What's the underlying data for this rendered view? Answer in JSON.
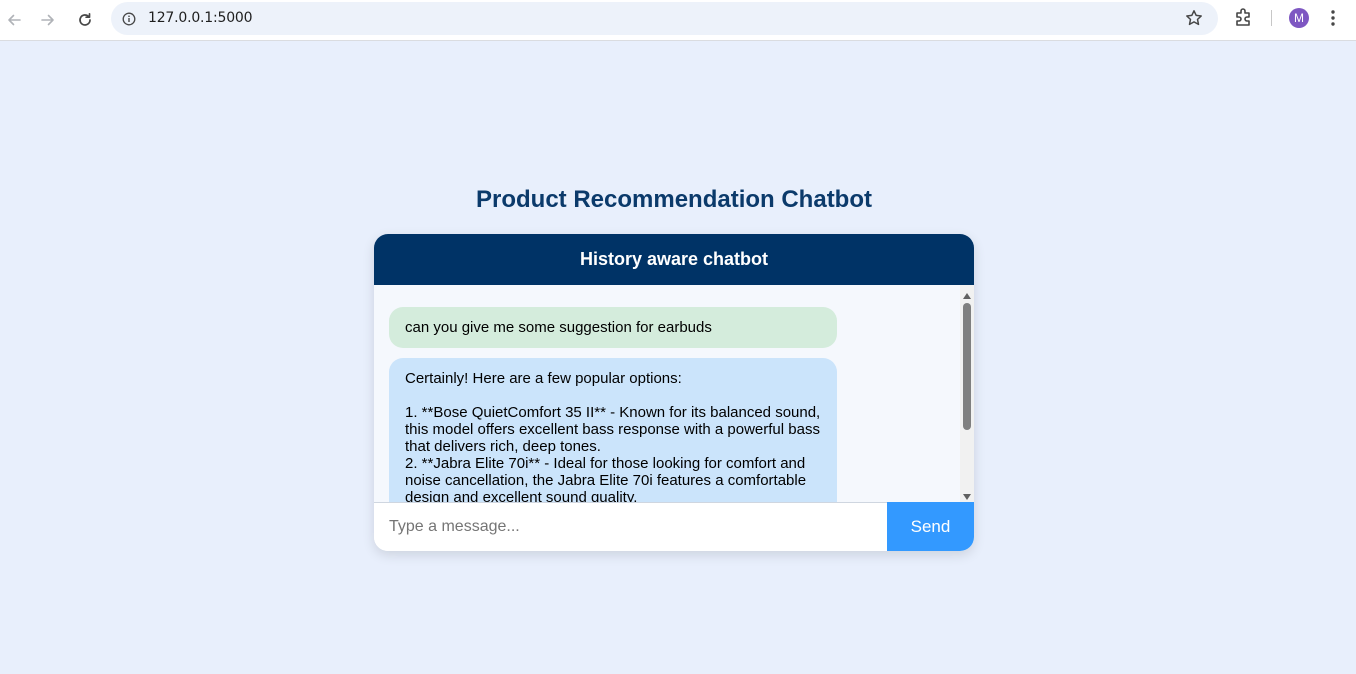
{
  "browser": {
    "url": "127.0.0.1:5000",
    "profile_initial": "M",
    "icons": [
      "back-arrow-icon",
      "forward-arrow-icon",
      "reload-icon",
      "site-info-icon",
      "star-icon",
      "extensions-icon",
      "more-vert-icon"
    ]
  },
  "page": {
    "title": "Product Recommendation Chatbot"
  },
  "chat": {
    "header": "History aware chatbot",
    "messages": [
      {
        "role": "user",
        "text": "can you give me some suggestion for earbuds"
      },
      {
        "role": "bot",
        "text": "Certainly! Here are a few popular options:\n\n1. **Bose QuietComfort 35 II** - Known for its balanced sound, this model offers excellent bass response with a powerful bass that delivers rich, deep tones.\n2. **Jabra Elite 70i** - Ideal for those looking for comfort and noise cancellation, the Jabra Elite 70i features a comfortable design and excellent sound quality."
      }
    ],
    "input_placeholder": "Type a message...",
    "input_value": "",
    "send_label": "Send"
  },
  "colors": {
    "page_bg": "#e8effc",
    "header_bg": "#003366",
    "title": "#0b3a6b",
    "user_bubble": "#d4ecdc",
    "bot_bubble": "#cbe4fb",
    "send_button": "#3399ff"
  }
}
